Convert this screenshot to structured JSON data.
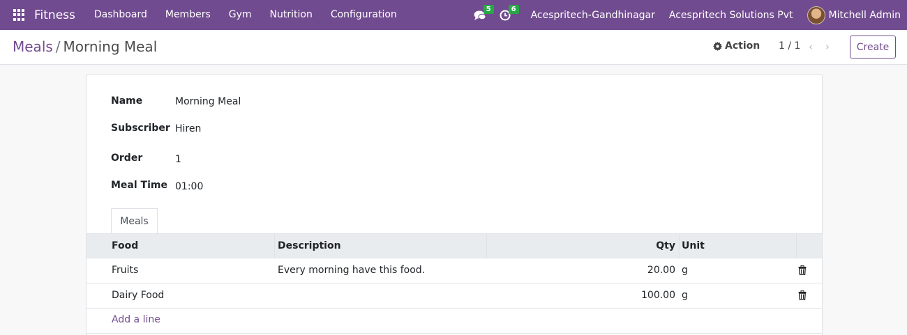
{
  "navbar": {
    "brand": "Fitness",
    "menu": [
      "Dashboard",
      "Members",
      "Gym",
      "Nutrition",
      "Configuration"
    ],
    "messages_count": "5",
    "activities_count": "6",
    "company_1": "Acespritech-Gandhinagar",
    "company_2": "Acespritech Solutions Pvt",
    "user": "Mitchell Admin",
    "accent_color": "#714b8f"
  },
  "control": {
    "breadcrumb_parent": "Meals",
    "breadcrumb_separator": "/",
    "breadcrumb_current": "Morning Meal",
    "action_label": "Action",
    "pager": "1 / 1",
    "create_label": "Create"
  },
  "form": {
    "name_label": "Name",
    "name_value": "Morning Meal",
    "subscriber_label": "Subscriber",
    "subscriber_value": "Hiren",
    "order_label": "Order",
    "order_value": "1",
    "meal_time_label": "Meal Time",
    "meal_time_value": "01:00"
  },
  "tabs": [
    {
      "label": "Meals",
      "active": true
    }
  ],
  "table": {
    "headers": {
      "food": "Food",
      "description": "Description",
      "qty": "Qty",
      "unit": "Unit"
    },
    "rows": [
      {
        "food": "Fruits",
        "description": "Every morning have this food.",
        "qty": "20.00",
        "unit": "g"
      },
      {
        "food": "Dairy Food",
        "description": "",
        "qty": "100.00",
        "unit": "g"
      }
    ],
    "add_line_label": "Add a line"
  }
}
